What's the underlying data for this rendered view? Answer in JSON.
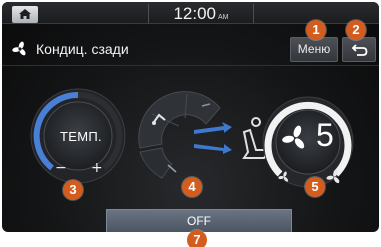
{
  "statusbar": {
    "time": "12:00",
    "ampm": "AM",
    "home_icon": "home-icon"
  },
  "titlebar": {
    "icon": "fan-icon",
    "title": "Кондиц. сзади",
    "menu_label": "Меню",
    "back_icon": "back-icon"
  },
  "controls": {
    "temperature": {
      "label": "ТЕМП.",
      "minus": "−",
      "plus": "+"
    },
    "fan": {
      "value": "5"
    },
    "off_label": "OFF"
  },
  "callouts": [
    "1",
    "2",
    "3",
    "4",
    "5",
    "7"
  ],
  "colors": {
    "accent": "#d25d1e",
    "temp_blue": "#4a7fd6",
    "off_button": "#5c6673"
  }
}
